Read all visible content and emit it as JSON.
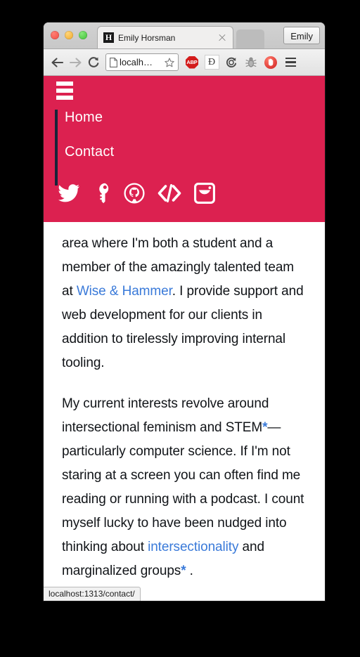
{
  "browser": {
    "tab": {
      "favicon_letter": "H",
      "title": "Emily Horsman",
      "close_icon": "close-icon"
    },
    "profile_label": "Emily",
    "toolbar": {
      "back_icon": "back-arrow-icon",
      "forward_icon": "forward-arrow-icon",
      "reload_icon": "reload-icon",
      "page_icon": "page-icon",
      "url_value": "localh…",
      "bookmark_icon": "star-icon",
      "extensions": [
        {
          "name": "adblock-plus-extension",
          "label": "ABP"
        },
        {
          "name": "pocket-extension",
          "label": "Đ"
        },
        {
          "name": "reload-circle-extension",
          "label": ""
        },
        {
          "name": "bug-extension",
          "label": ""
        },
        {
          "name": "stop-hand-extension",
          "label": ""
        }
      ],
      "menu_icon": "hamburger-menu-icon"
    }
  },
  "site": {
    "nav": {
      "menu_toggle_icon": "hamburger-icon",
      "links": [
        {
          "label": "Home"
        },
        {
          "label": "Contact"
        }
      ],
      "social": [
        {
          "name": "twitter-icon"
        },
        {
          "name": "key-icon"
        },
        {
          "name": "github-icon"
        },
        {
          "name": "code-brackets-icon"
        },
        {
          "name": "instagram-icon"
        }
      ]
    },
    "content": {
      "paragraph1": {
        "before_link": "area where I'm both a student and a member of the amazingly talented team at ",
        "link": "Wise & Hammer",
        "after_link": ". I provide support and web development for our clients in addition to tirelessly improving internal tooling."
      },
      "paragraph2": {
        "part1": "My current interests revolve around intersectional feminism and STEM",
        "footnote1": "*",
        "part2": "—particularly computer science. If I'm not staring at a screen you can often find me reading or running with a podcast. I count myself lucky to have been nudged into thinking about ",
        "link": "intersectionality",
        "part3": " and marginalized groups",
        "footnote2": "*",
        "part4": " ."
      },
      "cutoff_line": "(        )"
    }
  },
  "status": {
    "link_target": "localhost:1313/contact/"
  },
  "colors": {
    "nav_red": "#dc2150",
    "nav_accent": "#17243a",
    "link_blue": "#3a7ad9",
    "page_background": "#000000"
  }
}
